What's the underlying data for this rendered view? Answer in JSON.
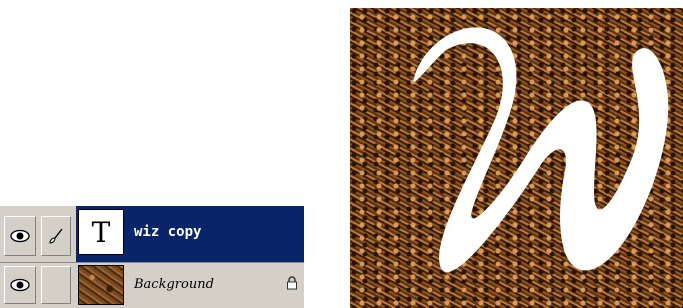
{
  "layers_panel": {
    "layers": [
      {
        "name": "wiz copy",
        "type": "text",
        "thumbnail_glyph": "T",
        "visible": true,
        "selected": true,
        "icons": [
          "eye-icon",
          "brush-icon"
        ]
      },
      {
        "name": "Background",
        "type": "image",
        "visible": true,
        "selected": false,
        "locked": true,
        "icons": [
          "eye-icon",
          "lock-icon"
        ]
      }
    ]
  },
  "colors": {
    "selected_row": "#0a246a",
    "panel_bg": "#d4d0c8",
    "texture_dark": "#3b1d08",
    "texture_light": "#b8773b",
    "letter_fill": "#ffffff"
  }
}
